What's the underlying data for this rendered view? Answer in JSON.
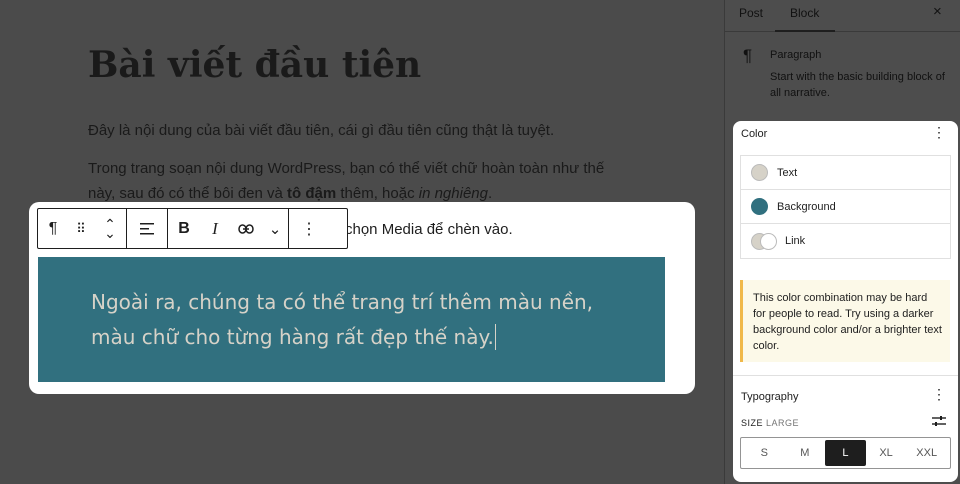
{
  "editor": {
    "post_title": "Bài viết đầu tiên",
    "paragraph1": "Đây là nội dung của bài viết đầu tiên, cái gì đầu tiên cũng thật là tuyệt.",
    "paragraph2": {
      "line1": "Trong trang soạn nội dung WordPress, bạn có thể viết chữ hoàn toàn như thế",
      "line2_start": "này, sau đó có thể bôi đen và ",
      "bold": "tô đậm",
      "mid": " thêm, hoặc ",
      "italic": "in nghiêng",
      "end": "."
    },
    "paragraph3_visible_tail": "chọn Media để chèn vào.",
    "selected_block_text": "Ngoài ra, chúng ta có thể trang trí thêm màu nền, màu chữ cho từng hàng rất đẹp thế này."
  },
  "toolbar": {
    "icons": [
      "pilcrow-icon",
      "drag-handle-icon",
      "move-up-down-icon",
      "align-left-icon",
      "bold-icon",
      "italic-icon",
      "link-icon",
      "chevron-down-icon",
      "more-options-icon"
    ],
    "pilcrow": "¶",
    "drag": "⠿",
    "move_up": "⌃",
    "move_down": "⌄",
    "align": "≡",
    "bold": "B",
    "italic": "I",
    "link": "⊂⊃",
    "more_rich": "⌄",
    "options": "⋮"
  },
  "sidebar": {
    "tabs": [
      {
        "label": "Post",
        "active": false
      },
      {
        "label": "Block",
        "active": true
      }
    ],
    "close": "×",
    "block_card": {
      "icon": "¶",
      "title": "Paragraph",
      "description": "Start with the basic building block of all narrative."
    },
    "color_panel": {
      "title": "Color",
      "menu": "⋮",
      "items": [
        {
          "label": "Text",
          "swatch": "#d6d2c8"
        },
        {
          "label": "Background",
          "swatch": "#31707f"
        },
        {
          "label": "Link",
          "swatch": [
            "#d6d2c8",
            "#ffffff"
          ]
        }
      ],
      "notice": "This color combination may be hard for people to read. Try using a darker background color and/or a brighter text color."
    },
    "typography_panel": {
      "title": "Typography",
      "menu": "⋮",
      "size_label": "SIZE",
      "size_current": "LARGE",
      "sizes": [
        "S",
        "M",
        "L",
        "XL",
        "XXL"
      ],
      "selected_size": "L"
    }
  },
  "colors": {
    "block_background": "#31707f",
    "block_text": "#d6d2c8",
    "notice_border": "#f0b849",
    "notice_background": "#fcf9e8"
  }
}
